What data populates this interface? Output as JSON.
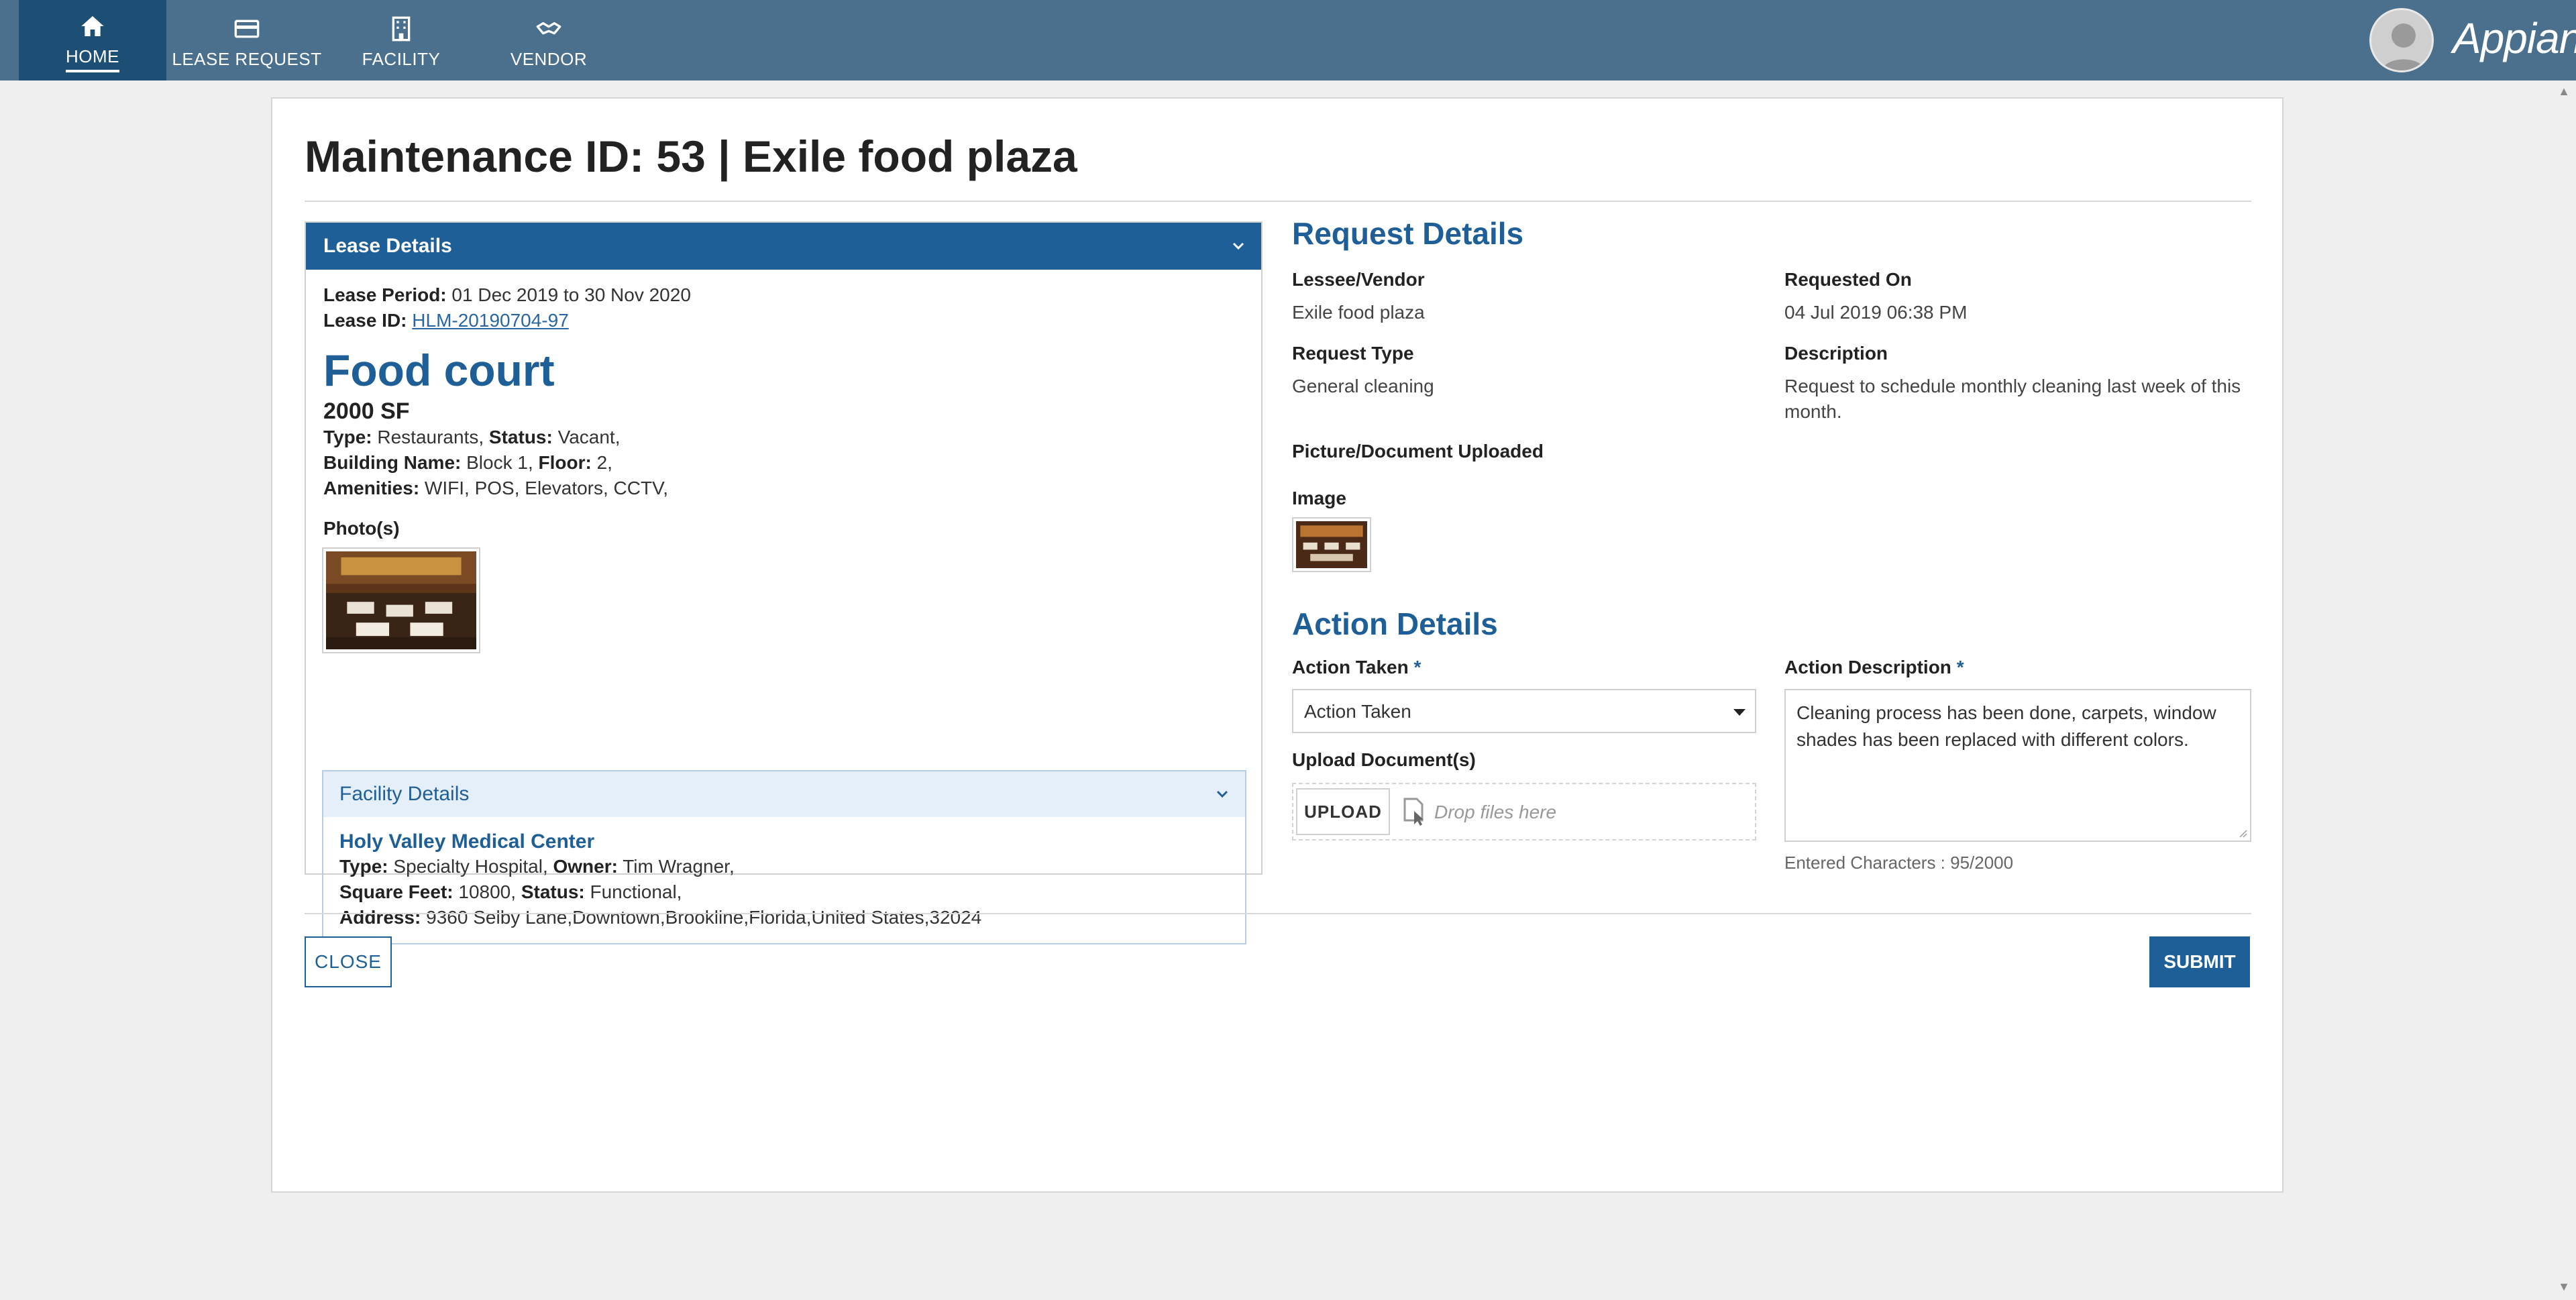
{
  "nav": {
    "items": [
      {
        "label": "HOME",
        "icon": "home-icon"
      },
      {
        "label": "LEASE REQUEST",
        "icon": "card-icon"
      },
      {
        "label": "FACILITY",
        "icon": "building-icon"
      },
      {
        "label": "VENDOR",
        "icon": "handshake-icon"
      }
    ],
    "active": "HOME",
    "brand": "Appian"
  },
  "page": {
    "title": "Maintenance ID: 53 | Exile food plaza"
  },
  "lease": {
    "header": "Lease Details",
    "period_label": "Lease Period:",
    "period_value": " 01 Dec 2019  to 30 Nov 2020",
    "id_label": "Lease ID:",
    "id_value": "HLM-20190704-97",
    "unit_title": "Food court",
    "size": "2000 SF",
    "type_label": "Type:",
    "type_value": " Restaurants, ",
    "status_label": "Status:",
    "status_value": " Vacant,",
    "building_label": "Building Name:",
    "building_value": " Block 1,  ",
    "floor_label": "Floor:",
    "floor_value": " 2,",
    "amenities_label": "Amenities:",
    "amenities_value": " WIFI, POS, Elevators, CCTV,",
    "photos_label": "Photo(s)"
  },
  "facility": {
    "header": "Facility Details",
    "name": "Holy Valley Medical Center",
    "type_label": "Type:",
    "type_value": " Specialty Hospital, ",
    "owner_label": "Owner:",
    "owner_value": " Tim Wragner,",
    "sqft_label": "Square Feet:",
    "sqft_value": " 10800, ",
    "status_label": "Status:",
    "status_value": " Functional,",
    "address_label": "Address:",
    "address_value": " 9360 Selby Lane,Downtown,Brookline,Florida,United States,32024"
  },
  "request": {
    "title": "Request Details",
    "lessee_label": "Lessee/Vendor",
    "lessee_value": "Exile food plaza",
    "requested_on_label": "Requested On",
    "requested_on_value": "04 Jul 2019 06:38 PM",
    "type_label": "Request Type",
    "type_value": "General cleaning",
    "description_label": "Description",
    "description_value": "Request to schedule monthly cleaning last week of this month.",
    "uploaded_label": "Picture/Document Uploaded",
    "image_label": "Image"
  },
  "action": {
    "title": "Action Details",
    "taken_label": "Action Taken",
    "required_mark": "*",
    "taken_value": "Action Taken",
    "upload_label": "Upload Document(s)",
    "upload_button": "UPLOAD",
    "drop_text": "Drop files here",
    "description_label": "Action Description",
    "description_value": "Cleaning process has been done, carpets, window shades has been replaced with different colors.",
    "char_count": "Entered Characters : 95/2000"
  },
  "buttons": {
    "close": "CLOSE",
    "submit": "SUBMIT"
  },
  "colors": {
    "nav_bg": "#4a708e",
    "nav_active": "#1d4e73",
    "accent": "#1f5f97",
    "page_bg": "#efefef"
  }
}
